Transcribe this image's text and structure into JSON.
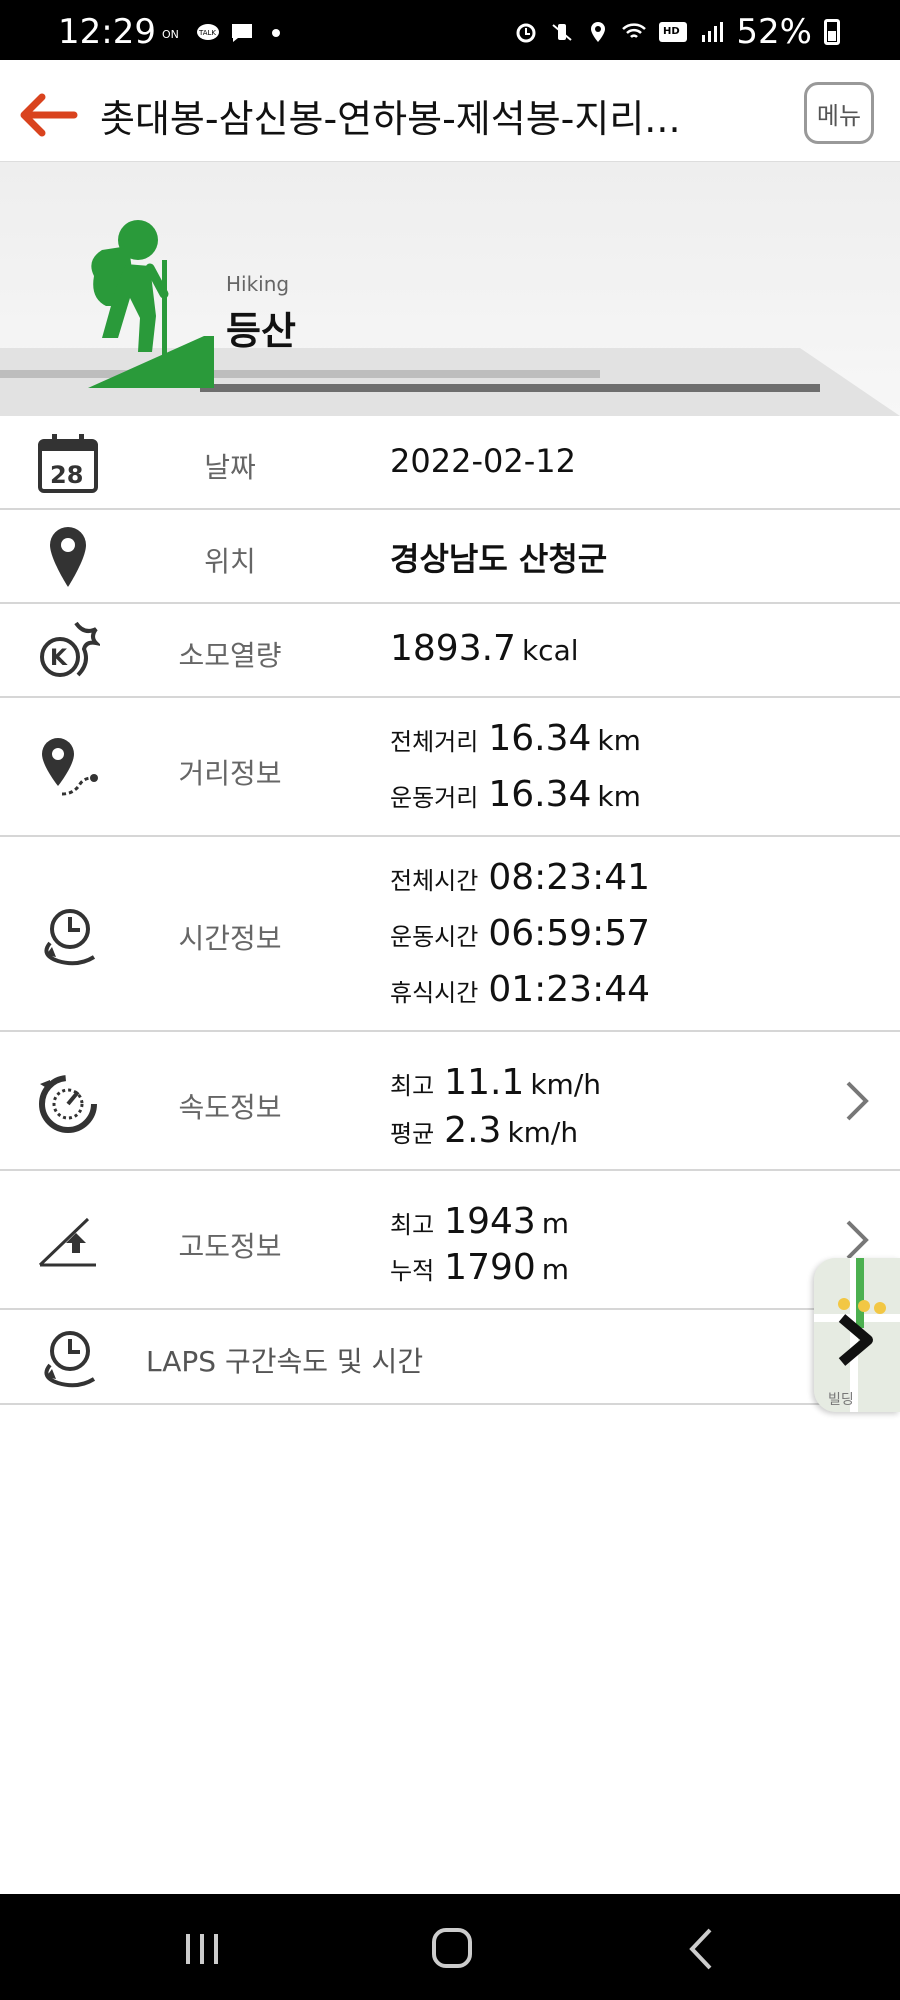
{
  "status_bar": {
    "time": "12:29",
    "battery": "52%",
    "hd_voice": "HD",
    "left_icons": [
      "kakao-news-icon",
      "talk-icon",
      "message-icon",
      "dot-icon"
    ],
    "right_icons": [
      "alarm-icon",
      "vibrate-icon",
      "location-icon",
      "wifi-icon",
      "hd-voice-icon",
      "signal-icon",
      "battery-icon"
    ]
  },
  "header": {
    "title": "촛대봉-삼신봉-연하봉-제석봉-지리...",
    "menu_label": "메뉴",
    "accent_color": "#d9431e"
  },
  "hero": {
    "subtitle": "Hiking",
    "title": "등산",
    "icon_color": "#2a9a3a"
  },
  "rows": {
    "date": {
      "label": "날짜",
      "value": "2022-02-12",
      "calendar_day": "28"
    },
    "location": {
      "label": "위치",
      "value": "경상남도 산청군"
    },
    "calories": {
      "label": "소모열량",
      "value": "1893.7",
      "unit": "kcal"
    },
    "distance": {
      "label": "거리정보",
      "total_label": "전체거리",
      "total_value": "16.34",
      "total_unit": "km",
      "moving_label": "운동거리",
      "moving_value": "16.34",
      "moving_unit": "km"
    },
    "time": {
      "label": "시간정보",
      "total_label": "전체시간",
      "total_value": "08:23:41",
      "moving_label": "운동시간",
      "moving_value": "06:59:57",
      "rest_label": "휴식시간",
      "rest_value": "01:23:44"
    },
    "speed": {
      "label": "속도정보",
      "max_label": "최고",
      "max_value": "11.1",
      "max_unit": "km/h",
      "avg_label": "평균",
      "avg_value": "2.3",
      "avg_unit": "km/h"
    },
    "altitude": {
      "label": "고도정보",
      "max_label": "최고",
      "max_value": "1943",
      "max_unit": "m",
      "cum_label": "누적",
      "cum_value": "1790",
      "cum_unit": "m"
    },
    "laps": {
      "label": "LAPS 구간속도 및 시간"
    }
  },
  "map_thumb": {
    "label": "빌딩"
  }
}
